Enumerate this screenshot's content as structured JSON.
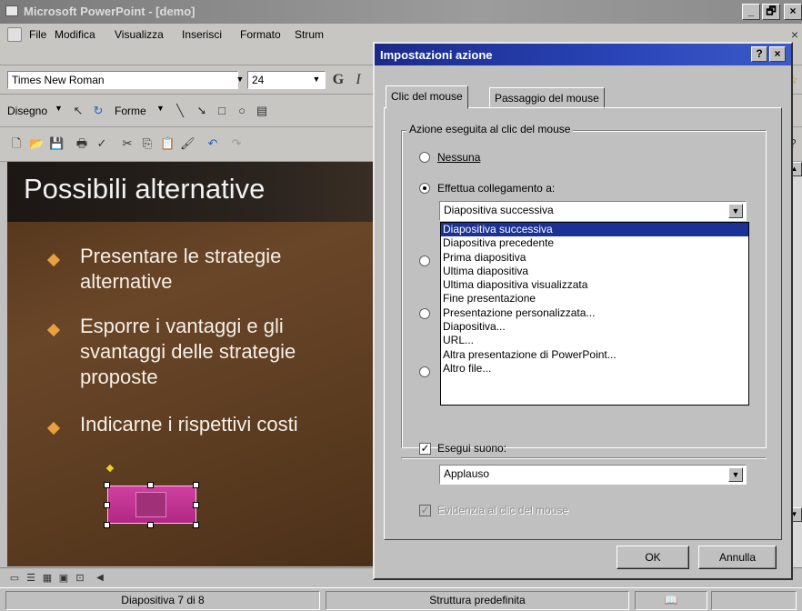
{
  "window": {
    "title": "Microsoft PowerPoint - [demo]",
    "min": "_",
    "max": "🗗",
    "close": "×"
  },
  "menu": {
    "file": "File",
    "edit": "Modifica",
    "view": "Visualizza",
    "insert": "Inserisci",
    "format": "Formato",
    "tools": "Strum"
  },
  "formatting": {
    "font": "Times New Roman",
    "size": "24",
    "bold": "G",
    "italic": "I"
  },
  "drawing": {
    "draw": "Disegno",
    "shapes": "Forme"
  },
  "slide": {
    "title": "Possibili alternative",
    "bullets": [
      "Presentare le strategie alternative",
      "Esporre i vantaggi e gli svantaggi delle strategie proposte",
      "Indicarne i rispettivi costi"
    ]
  },
  "dialog": {
    "title": "Impostazioni azione",
    "help": "?",
    "close": "×",
    "tabs": [
      "Clic del mouse",
      "Passaggio del mouse"
    ],
    "group_label": "Azione eseguita al clic del mouse",
    "radio_none": "Nessuna",
    "radio_link": "Effettua collegamento a:",
    "link_value": "Diapositiva successiva",
    "link_options": [
      "Diapositiva successiva",
      "Diapositiva precedente",
      "Prima diapositiva",
      "Ultima diapositiva",
      "Ultima diapositiva visualizzata",
      "Fine presentazione",
      "Presentazione personalizzata...",
      "Diapositiva...",
      "URL...",
      "Altra presentazione di PowerPoint...",
      "Altro file..."
    ],
    "sound_label": "Esegui suono:",
    "sound_value": "Applauso",
    "highlight_label": "Evidenzia al clic del mouse",
    "ok": "OK",
    "cancel": "Annulla"
  },
  "status": {
    "slide": "Diapositiva 7 di 8",
    "design": "Struttura predefinita"
  },
  "colors": {
    "accent": "#1a3296",
    "slide_bg": "#5a3b20",
    "bullet": "#e8a040"
  }
}
